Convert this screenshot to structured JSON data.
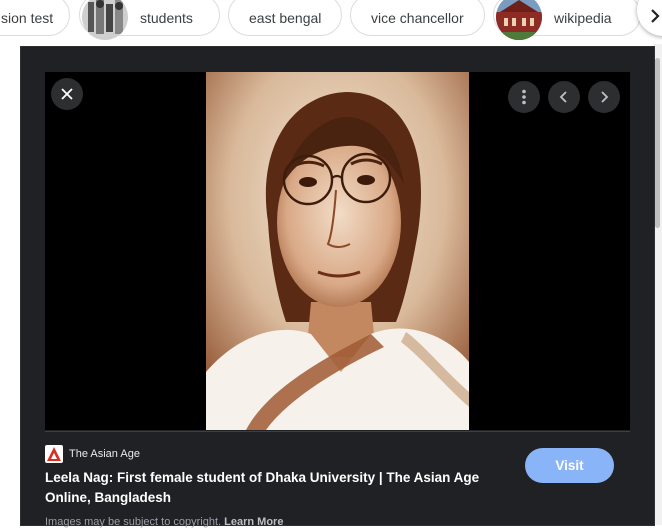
{
  "chips": [
    {
      "label": "sion test",
      "has_thumb": false
    },
    {
      "label": "students",
      "has_thumb": true,
      "thumb": "group-photo"
    },
    {
      "label": "east bengal",
      "has_thumb": false
    },
    {
      "label": "vice chancellor",
      "has_thumb": false
    },
    {
      "label": "wikipedia",
      "has_thumb": true,
      "thumb": "red-building-photo"
    }
  ],
  "chips_next_icon": "chevron-right-icon",
  "viewer": {
    "close_icon": "close-icon",
    "more_icon": "more-vert-icon",
    "prev_icon": "chevron-left-icon",
    "next_icon": "chevron-right-icon",
    "image_subject": "sepia portrait"
  },
  "source": {
    "logo_icon": "asian-age-logo-icon",
    "name": "The Asian Age"
  },
  "title_line1": "Leela Nag: First female student of Dhaka University | The Asian Age",
  "title_line2": "Online, Bangladesh",
  "visit_label": "Visit",
  "copyright": {
    "text": "Images may be subject to copyright.",
    "link": "Learn More"
  },
  "colors": {
    "panel_bg": "#202124",
    "accent": "#8ab4f8",
    "sepia_light": "#e9d8c3",
    "sepia_dark": "#6b3a1f"
  }
}
